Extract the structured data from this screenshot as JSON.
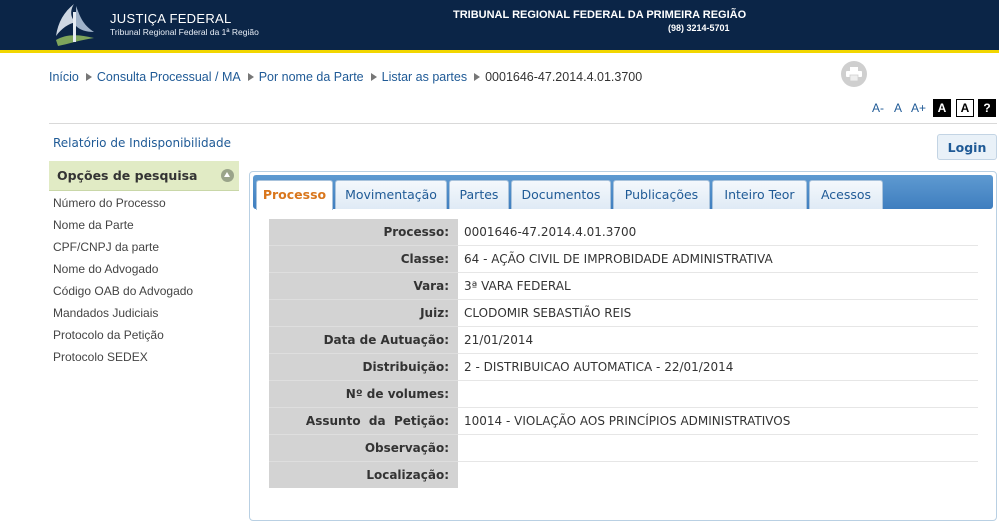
{
  "header": {
    "logo_title": "JUSTIÇA FEDERAL",
    "logo_subtitle": "Tribunal Regional Federal da 1ª Região",
    "court_name": "TRIBUNAL REGIONAL FEDERAL DA PRIMEIRA REGIÃO",
    "phone": "(98) 3214-5701",
    "colors": {
      "background": "#0b2547",
      "accent": "#f2d600"
    }
  },
  "breadcrumb": {
    "items": [
      "Início",
      "Consulta Processual / MA",
      "Por nome da Parte",
      "Listar as partes"
    ],
    "current": "0001646-47.2014.4.01.3700"
  },
  "toolbar": {
    "print_icon": "printer-icon",
    "font_decrease": "A-",
    "font_normal": "A",
    "font_increase": "A+",
    "contrast_dark": "A",
    "contrast_light": "A",
    "help": "?"
  },
  "sidebar": {
    "report_link": "Relatório de Indisponibilidade",
    "options_title": "Opções de pesquisa",
    "items": [
      "Número do Processo",
      "Nome da Parte",
      "CPF/CNPJ da parte",
      "Nome do Advogado",
      "Código OAB do Advogado",
      "Mandados Judiciais",
      "Protocolo da Petição",
      "Protocolo SEDEX"
    ]
  },
  "login": {
    "label": "Login"
  },
  "tabs": [
    {
      "label": "Processo",
      "active": true
    },
    {
      "label": "Movimentação",
      "active": false
    },
    {
      "label": "Partes",
      "active": false
    },
    {
      "label": "Documentos",
      "active": false
    },
    {
      "label": "Publicações",
      "active": false
    },
    {
      "label": "Inteiro Teor",
      "active": false
    },
    {
      "label": "Acessos",
      "active": false
    }
  ],
  "details": [
    {
      "label": "Processo:",
      "value": "0001646-47.2014.4.01.3700"
    },
    {
      "label": "Classe:",
      "value": "64 - AÇÃO CIVIL DE IMPROBIDADE ADMINISTRATIVA"
    },
    {
      "label": "Vara:",
      "value": "3ª VARA FEDERAL"
    },
    {
      "label": "Juiz:",
      "value": "CLODOMIR SEBASTIÃO REIS"
    },
    {
      "label": "Data de Autuação:",
      "value": "21/01/2014"
    },
    {
      "label": "Distribuição:",
      "value": "2 - DISTRIBUICAO AUTOMATICA - 22/01/2014"
    },
    {
      "label": "Nº de volumes:",
      "value": ""
    },
    {
      "label": "Assunto  da  Petição:",
      "value": "10014 - VIOLAÇÃO AOS PRINCÍPIOS ADMINISTRATIVOS"
    },
    {
      "label": "Observação:",
      "value": ""
    },
    {
      "label": "Localização:",
      "value": ""
    }
  ]
}
